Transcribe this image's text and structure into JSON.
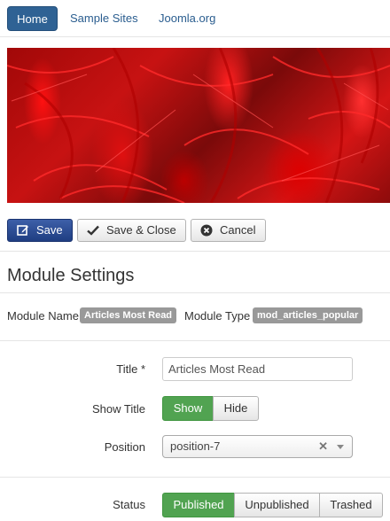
{
  "nav": {
    "items": [
      {
        "label": "Home",
        "active": true
      },
      {
        "label": "Sample Sites",
        "active": false
      },
      {
        "label": "Joomla.org",
        "active": false
      }
    ]
  },
  "toolbar": {
    "save_label": "Save",
    "save_close_label": "Save & Close",
    "cancel_label": "Cancel"
  },
  "section": {
    "title": "Module Settings"
  },
  "meta": {
    "module_name_label": "Module Name",
    "module_name_value": "Articles Most Read",
    "module_type_label": "Module Type",
    "module_type_value": "mod_articles_popular"
  },
  "form": {
    "title_label": "Title *",
    "title_value": "Articles Most Read",
    "show_title_label": "Show Title",
    "show_title_options": [
      "Show",
      "Hide"
    ],
    "show_title_selected": "Show",
    "position_label": "Position",
    "position_value": "position-7",
    "status_label": "Status",
    "status_options": [
      "Published",
      "Unpublished",
      "Trashed"
    ],
    "status_selected": "Published"
  },
  "colors": {
    "primary": "#2f6294",
    "save_button": "#2a4b92",
    "success": "#51a351",
    "badge": "#999999"
  }
}
